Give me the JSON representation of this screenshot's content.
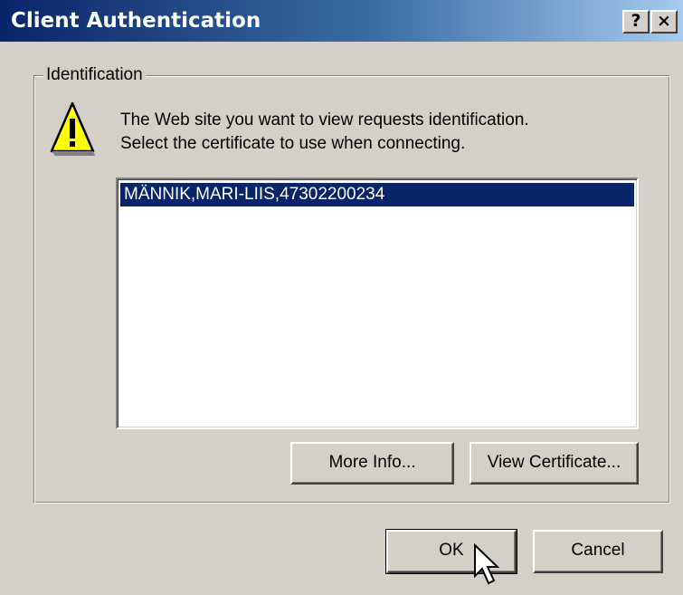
{
  "window": {
    "title": "Client Authentication",
    "help_button": "?",
    "close_button": "×"
  },
  "identification_group": {
    "label": "Identification",
    "icon": "warning-icon",
    "message_line1": "The Web site you want to view requests identification.",
    "message_line2": "Select the certificate to use when connecting."
  },
  "certificates": {
    "items": [
      {
        "label": "MÄNNIK,MARI-LIIS,47302200234",
        "selected": true
      }
    ]
  },
  "buttons": {
    "more_info": "More Info...",
    "view_certificate": "View Certificate...",
    "ok": "OK",
    "cancel": "Cancel"
  },
  "colors": {
    "dialog_bg": "#d4d0c8",
    "titlebar_start": "#0a246a",
    "selection": "#0a246a",
    "warning_fill": "#ffff00"
  }
}
